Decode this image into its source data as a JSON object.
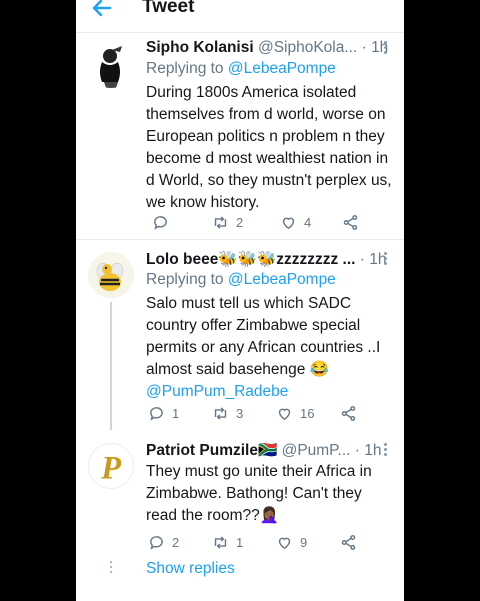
{
  "header": {
    "title": "Tweet"
  },
  "tweets": [
    {
      "name": "Sipho Kolanisi",
      "handle_time": "@SiphoKola... · 1h",
      "replying_prefix": "Replying to ",
      "replying_to": "@LebeaPompe",
      "text": "During 1800s America isolated themselves from d world, worse on European politics n problem n they become d most wealthiest nation in d World, so they mustn't perplex us, we know history.",
      "replies": "",
      "retweets": "2",
      "likes": "4"
    },
    {
      "name": "Lolo beee🐝🐝🐝zzzzzzzz ...",
      "handle_time": "· 1h",
      "replying_prefix": "Replying to ",
      "replying_to": "@LebeaPompe",
      "text": "Salo must tell us which SADC country offer Zimbabwe special permits or any African countries ..I almost said basehenge 😂",
      "mention_line": "@PumPum_Radebe",
      "replies": "1",
      "retweets": "3",
      "likes": "16"
    },
    {
      "name": "Patriot Pumzile🇿🇦",
      "handle_time": "@PumP... · 1h",
      "text": "They must go unite their Africa in Zimbabwe. Bathong! Can't they read the room??🤦🏾‍♀️",
      "replies": "2",
      "retweets": "1",
      "likes": "9"
    }
  ],
  "show_replies": "Show replies",
  "colors": {
    "accent": "#1da1f2",
    "muted": "#657786"
  }
}
